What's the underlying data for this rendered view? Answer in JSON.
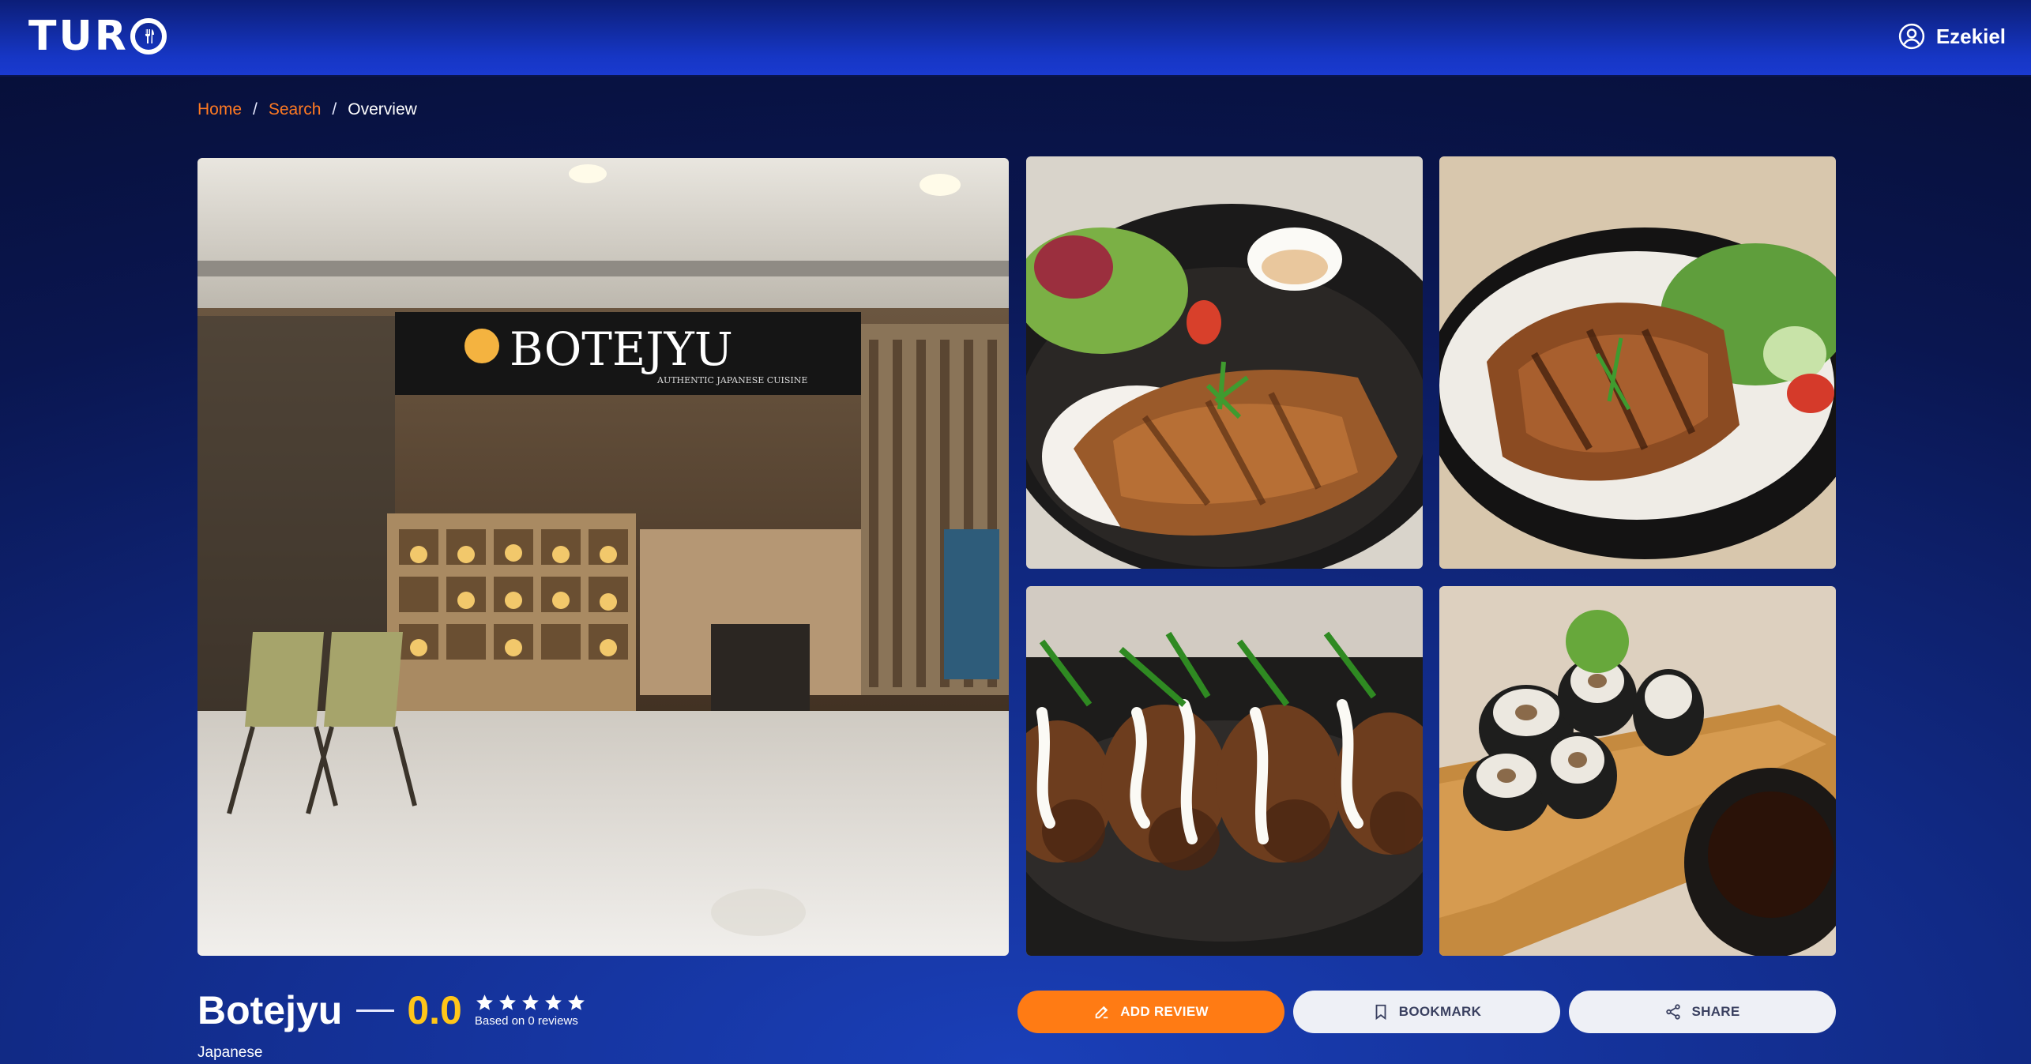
{
  "app": {
    "brand": "TURO",
    "brand_letters": "TUR",
    "user_name": "Ezekiel"
  },
  "breadcrumb": {
    "items": [
      "Home",
      "Search"
    ],
    "separator": "/",
    "current": "Overview"
  },
  "gallery": {
    "main_sign_text": "BOTEJYU",
    "main_sign_subtext": "AUTHENTIC JAPANESE CUISINE"
  },
  "restaurant": {
    "name": "Botejyu",
    "rating": "0.0",
    "stars_total": 5,
    "review_summary": "Based on 0 reviews",
    "cuisine": "Japanese"
  },
  "actions": {
    "add_review": "ADD REVIEW",
    "bookmark": "BOOKMARK",
    "share": "SHARE"
  },
  "colors": {
    "accent": "#ff7b14",
    "rating": "#ffc619",
    "link": "#ff7a22",
    "header": "#1636c4"
  },
  "icons": {
    "user": "user-circle-icon",
    "logo": "fork-knife-icon",
    "add_review": "edit-icon",
    "bookmark": "bookmark-icon",
    "share": "share-icon",
    "star": "star-icon"
  }
}
